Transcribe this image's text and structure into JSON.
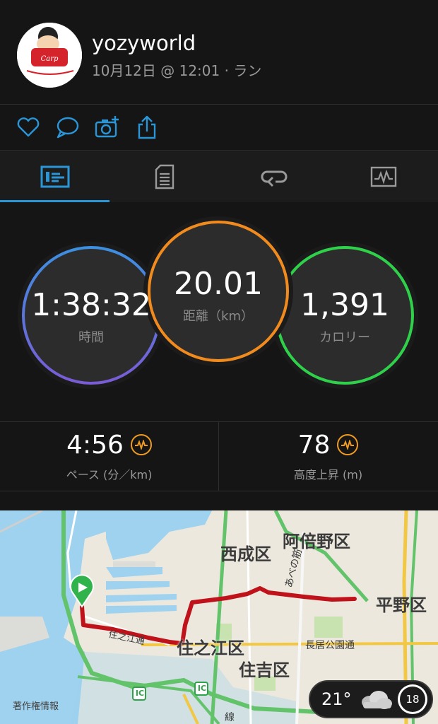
{
  "header": {
    "username": "yozyworld",
    "subtitle": "10月12日 @ 12:01 · ラン"
  },
  "actions": {
    "icons": [
      "heart-icon",
      "comment-icon",
      "camera-add-icon",
      "share-icon"
    ]
  },
  "tabs": [
    {
      "icon": "summary-icon",
      "selected": true
    },
    {
      "icon": "details-icon",
      "selected": false
    },
    {
      "icon": "laps-icon",
      "selected": false
    },
    {
      "icon": "charts-icon",
      "selected": false
    }
  ],
  "metrics": {
    "time": {
      "value": "1:38:32",
      "label": "時間"
    },
    "distance": {
      "value": "20.01",
      "label": "距離（km）"
    },
    "calories": {
      "value": "1,391",
      "label": "カロリー"
    }
  },
  "stats": {
    "pace": {
      "value": "4:56",
      "label": "ペース (分／km)"
    },
    "elevation": {
      "value": "78",
      "label": "高度上昇 (m)"
    }
  },
  "map": {
    "labels": {
      "nishinari": "西成区",
      "abeno": "阿倍野区",
      "hirano": "平野区",
      "suminoe": "住之江区",
      "sumiyoshi": "住吉区",
      "nagai_koen": "長居公園通",
      "abenosuji": "あべの筋",
      "suminoe_dori": "住之江通",
      "copyright": "著作権情報",
      "ic1": "IC",
      "ic2": "IC",
      "line": "線"
    },
    "weather": {
      "temperature": "21°",
      "icon": "cloud-icon",
      "badge": "18"
    }
  },
  "colors": {
    "accent_blue": "#2a96d8",
    "time_ring": [
      "#3d8fe0",
      "#7a5cd6"
    ],
    "distance_ring": "#f28b1e",
    "calorie_ring": "#2fd14b",
    "route": "#c0121b",
    "zap_orange": "#f09b20"
  }
}
